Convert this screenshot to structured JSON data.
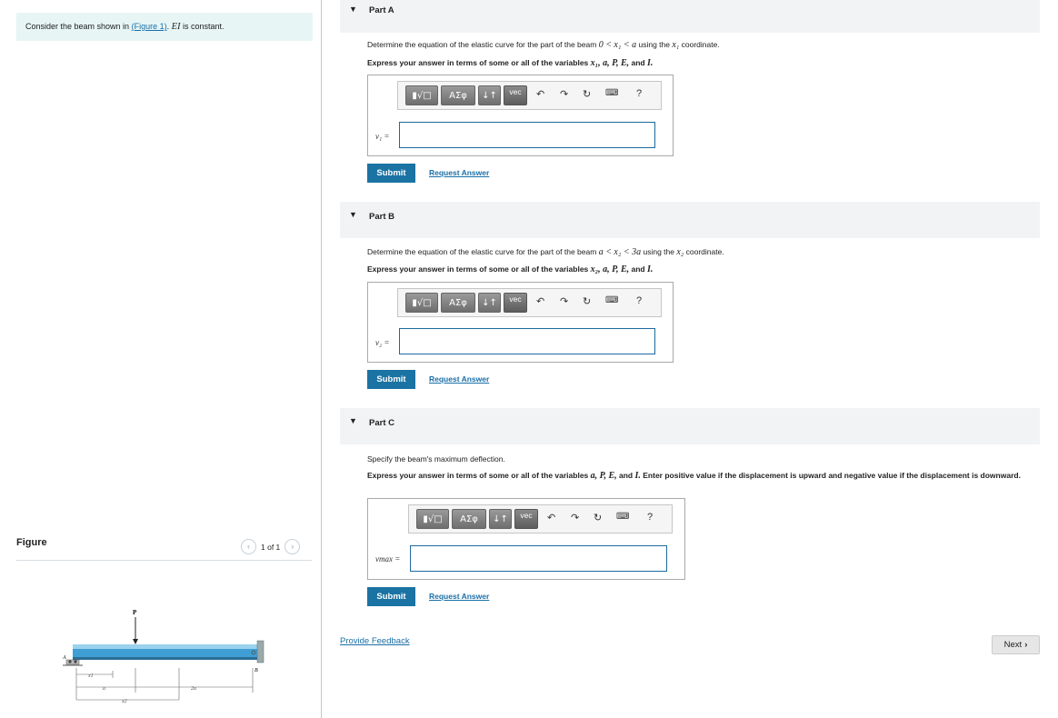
{
  "intro": {
    "text_before": "Consider the beam shown in ",
    "link": "(Figure 1)",
    "text_math": "EI",
    "text_after": " is constant."
  },
  "figure": {
    "label": "Figure",
    "pager": "1 of 1",
    "prev_icon": "chevron-left-icon",
    "next_icon": "chevron-right-icon",
    "labels": {
      "load": "P",
      "support_a": "A",
      "support_b": "B",
      "x1": "x1",
      "x2": "x2",
      "a": "a",
      "two_a": "2a"
    }
  },
  "parts": [
    {
      "title": "Part A",
      "question_pre": "Determine the equation of the elastic curve for the part of the beam ",
      "question_math": "0 < x₁ < a",
      "question_post": " using the ",
      "question_var": "x₁",
      "question_end": " coordinate.",
      "express": "Express your answer in terms of some or all of the variables ",
      "express_vars": "x₁, a, P, E,",
      "express_and": " and ",
      "express_last": "I.",
      "answer_label": "v₁ =",
      "submit": "Submit",
      "request": "Request Answer"
    },
    {
      "title": "Part B",
      "question_pre": "Determine the equation of the elastic curve for the part of the beam ",
      "question_math": "a < x₂ < 3a",
      "question_post": " using the ",
      "question_var": "x₂",
      "question_end": " coordinate.",
      "express": "Express your answer in terms of some or all of the variables ",
      "express_vars": "x₂, a, P, E,",
      "express_and": " and ",
      "express_last": "I.",
      "answer_label": "v₂ =",
      "submit": "Submit",
      "request": "Request Answer"
    },
    {
      "title": "Part C",
      "question": "Specify the beam's maximum deflection.",
      "express": "Express your answer in terms of some or all of the variables ",
      "express_vars": "a, P, E,",
      "express_and": " and ",
      "express_last": "I.",
      "express_tail": " Enter positive value if the displacement is upward and negative value if the displacement is downward.",
      "answer_label": "vmax =",
      "submit": "Submit",
      "request": "Request Answer"
    }
  ],
  "toolbar": {
    "templates": "▮√□",
    "greek": "ΑΣφ",
    "arrows": "↓↑",
    "vec": "vec",
    "undo_icon": "undo-icon",
    "redo_icon": "redo-icon",
    "reset_icon": "reset-icon",
    "keyboard_icon": "keyboard-icon",
    "help": "?"
  },
  "footer": {
    "feedback": "Provide Feedback",
    "next": "Next"
  },
  "colors": {
    "accent": "#1a73a3",
    "link": "#1a6fa8",
    "intro_bg": "#e7f5f5",
    "beam": "#4aa7d8"
  }
}
